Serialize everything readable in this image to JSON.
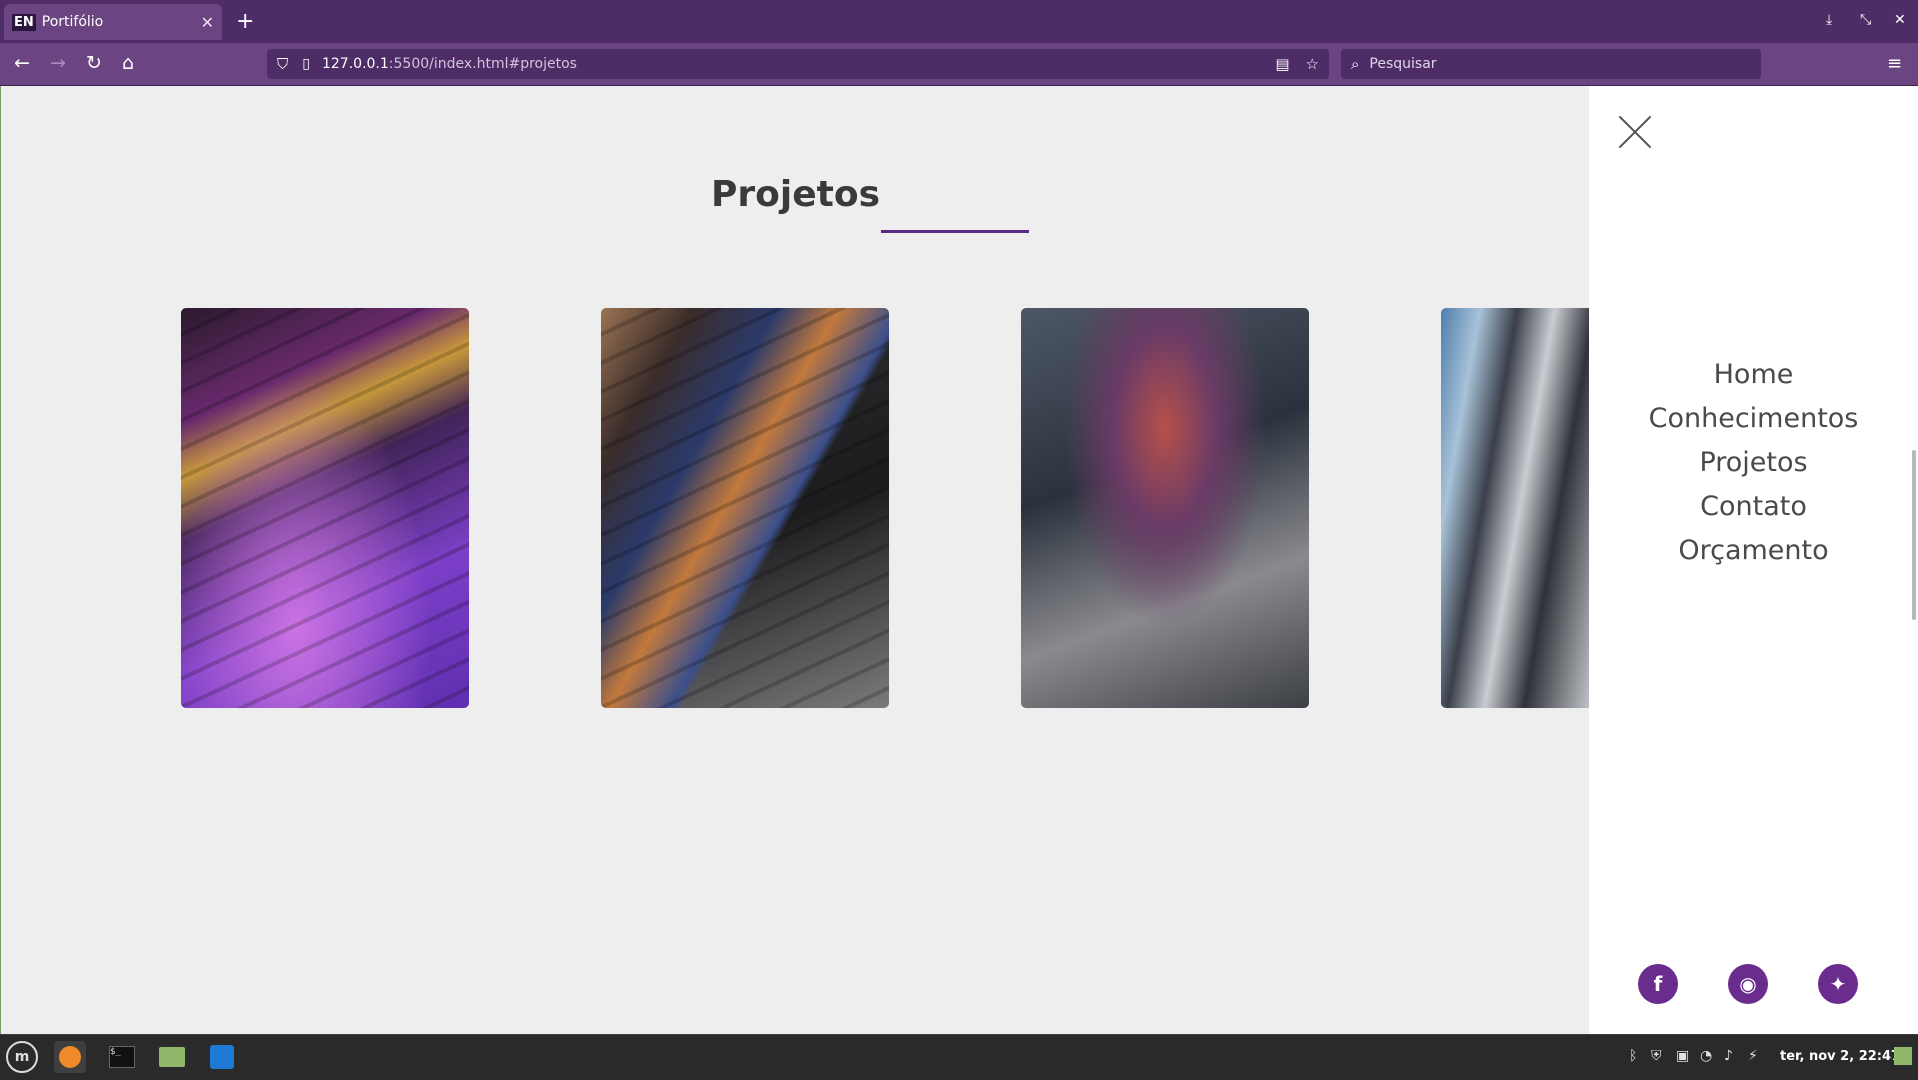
{
  "browser": {
    "tab": {
      "favicon_text": "EN",
      "title": "Portifólio",
      "close": "✕"
    },
    "new_tab": "+",
    "window_controls": [
      "⤓",
      "⤡",
      "✕"
    ],
    "nav": {
      "back": "←",
      "forward": "→",
      "reload": "↻",
      "home": "⌂"
    },
    "url": {
      "host": "127.0.0.1",
      "path": ":5500/index.html#projetos"
    },
    "search": {
      "placeholder": "Pesquisar"
    },
    "menu_icon": "≡"
  },
  "page": {
    "section_title": "Projetos",
    "accent_color": "#5a2a82",
    "projects": [
      {
        "image": "keyboard-closeup"
      },
      {
        "image": "laptop-touchbar"
      },
      {
        "image": "laptop-on-desk"
      },
      {
        "image": "laptop-blurred"
      }
    ]
  },
  "side_menu": {
    "items": [
      "Home",
      "Conhecimentos",
      "Projetos",
      "Contato",
      "Orçamento"
    ],
    "social": [
      {
        "name": "facebook-icon",
        "glyph": "f"
      },
      {
        "name": "github-icon",
        "glyph": "◉"
      },
      {
        "name": "twitter-icon",
        "glyph": "✦"
      }
    ],
    "social_color": "#6a2d8e"
  },
  "taskbar": {
    "clock": "ter, nov 2, 22:47"
  }
}
